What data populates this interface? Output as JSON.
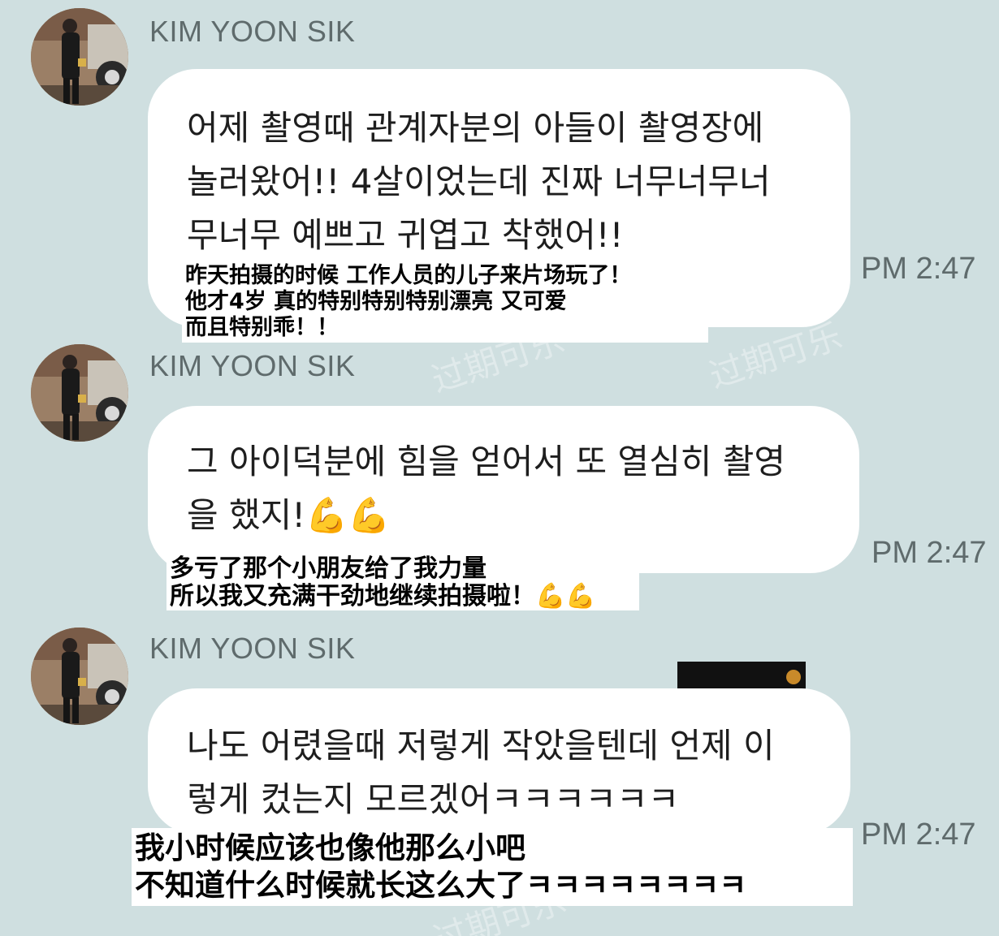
{
  "chat": {
    "watermark": "过期可乐",
    "messages": [
      {
        "sender": "KIM YOON SIK",
        "text": "어제 촬영때 관계자분의 아들이 촬영장에\n놀러왔어!! 4살이었는데 진짜 너무너무너\n무너무 예쁘고 귀엽고 착했어!!",
        "translation": "昨天拍摄的时候 工作人员的儿子来片场玩了！\n他才4岁 真的特别特别特别漂亮 又可爱\n而且特别乖！！",
        "time": "PM 2:47"
      },
      {
        "sender": "KIM YOON SIK",
        "text": "그 아이덕분에 힘을 얻어서 또 열심히 촬영\n을 했지!💪💪",
        "translation": "多亏了那个小朋友给了我力量\n所以我又充满干劲地继续拍摄啦！💪💪",
        "time": "PM 2:47"
      },
      {
        "sender": "KIM YOON SIK",
        "text": "나도 어렸을때 저렇게 작았을텐데 언제 이\n렇게 컸는지 모르겠어ㅋㅋㅋㅋㅋㅋ",
        "translation": "我小时候应该也像他那么小吧\n不知道什么时候就长这么大了ㅋㅋㅋㅋㅋㅋㅋㅋ",
        "time": "PM 2:47"
      }
    ]
  },
  "colors": {
    "background": "#cfdfe0",
    "bubble": "#ffffff",
    "meta_text": "#5f6b6c"
  },
  "icons": {
    "avatar": "profile-photo",
    "emoji": "flexed-biceps"
  }
}
